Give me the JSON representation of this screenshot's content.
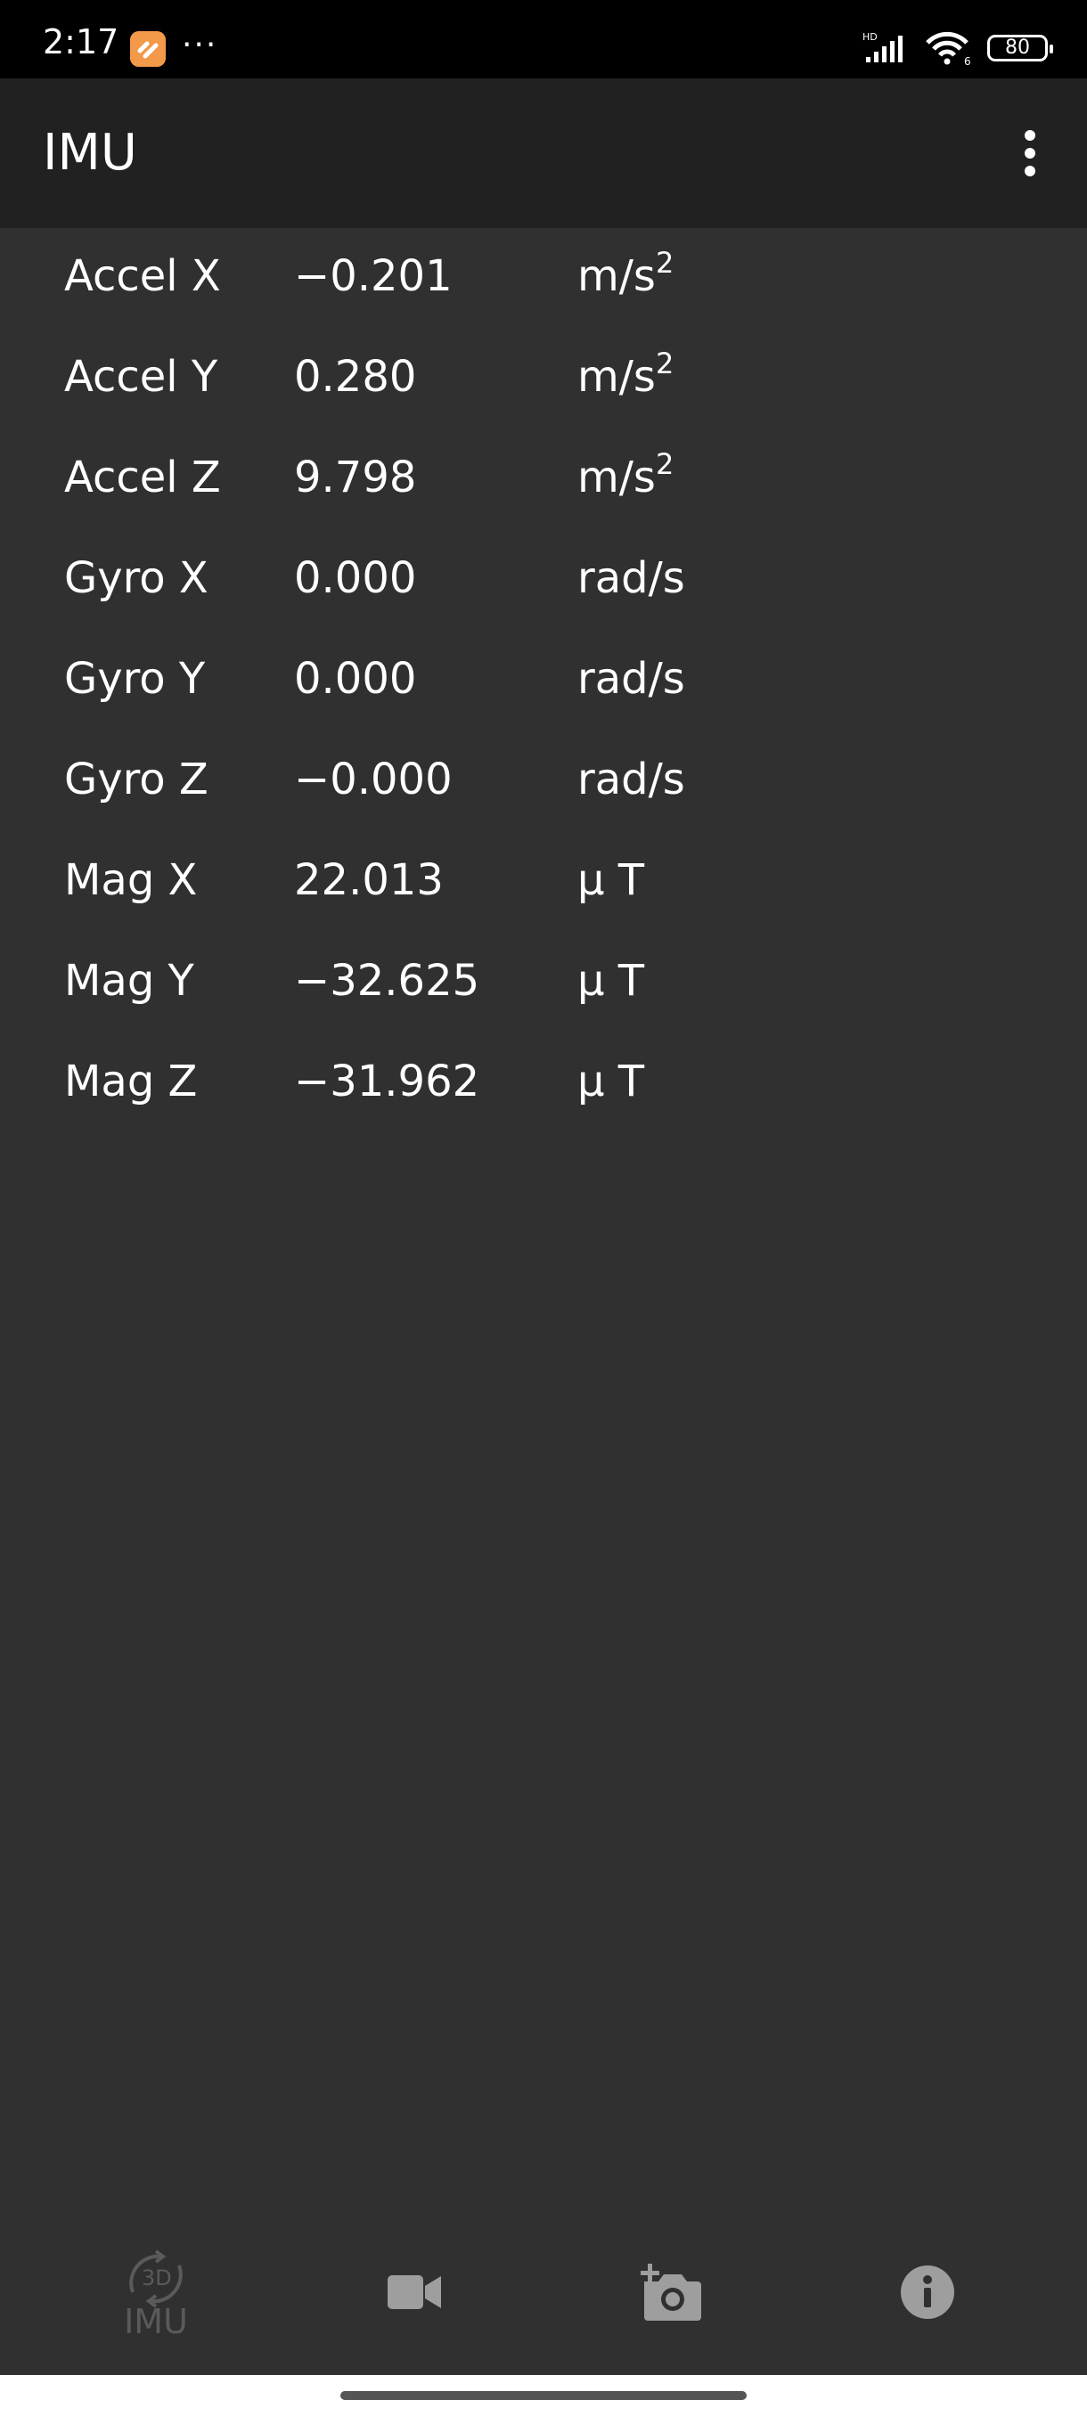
{
  "status_bar": {
    "time": "2:17",
    "dots": "···",
    "network_badge": "HD",
    "wifi_badge": "6",
    "battery": "80"
  },
  "app_bar": {
    "title": "IMU",
    "menu_icon": "more-vert-icon"
  },
  "readings": [
    {
      "label": "Accel X",
      "value": "−0.201",
      "unit": "m/s",
      "unit_sup": "2"
    },
    {
      "label": "Accel Y",
      "value": "0.280",
      "unit": "m/s",
      "unit_sup": "2"
    },
    {
      "label": "Accel Z",
      "value": "9.798",
      "unit": "m/s",
      "unit_sup": "2"
    },
    {
      "label": "Gyro X",
      "value": "0.000",
      "unit": "rad/s",
      "unit_sup": ""
    },
    {
      "label": "Gyro Y",
      "value": "0.000",
      "unit": "rad/s",
      "unit_sup": ""
    },
    {
      "label": "Gyro Z",
      "value": "−0.000",
      "unit": "rad/s",
      "unit_sup": ""
    },
    {
      "label": "Mag X",
      "value": "22.013",
      "unit": "μ T",
      "unit_sup": ""
    },
    {
      "label": "Mag Y",
      "value": "−32.625",
      "unit": "μ T",
      "unit_sup": ""
    },
    {
      "label": "Mag Z",
      "value": "−31.962",
      "unit": "μ T",
      "unit_sup": ""
    }
  ],
  "bottom_nav": {
    "imu_badge": "3D",
    "imu_label": "IMU",
    "video_icon": "video-camera-icon",
    "camera_icon": "add-photo-icon",
    "info_icon": "info-icon"
  },
  "colors": {
    "background": "#303030",
    "app_bar": "#212121",
    "status_bar": "#000000",
    "text": "#ffffff",
    "nav_icon": "#9e9e9e",
    "nav_disabled": "#5a5a5a"
  }
}
